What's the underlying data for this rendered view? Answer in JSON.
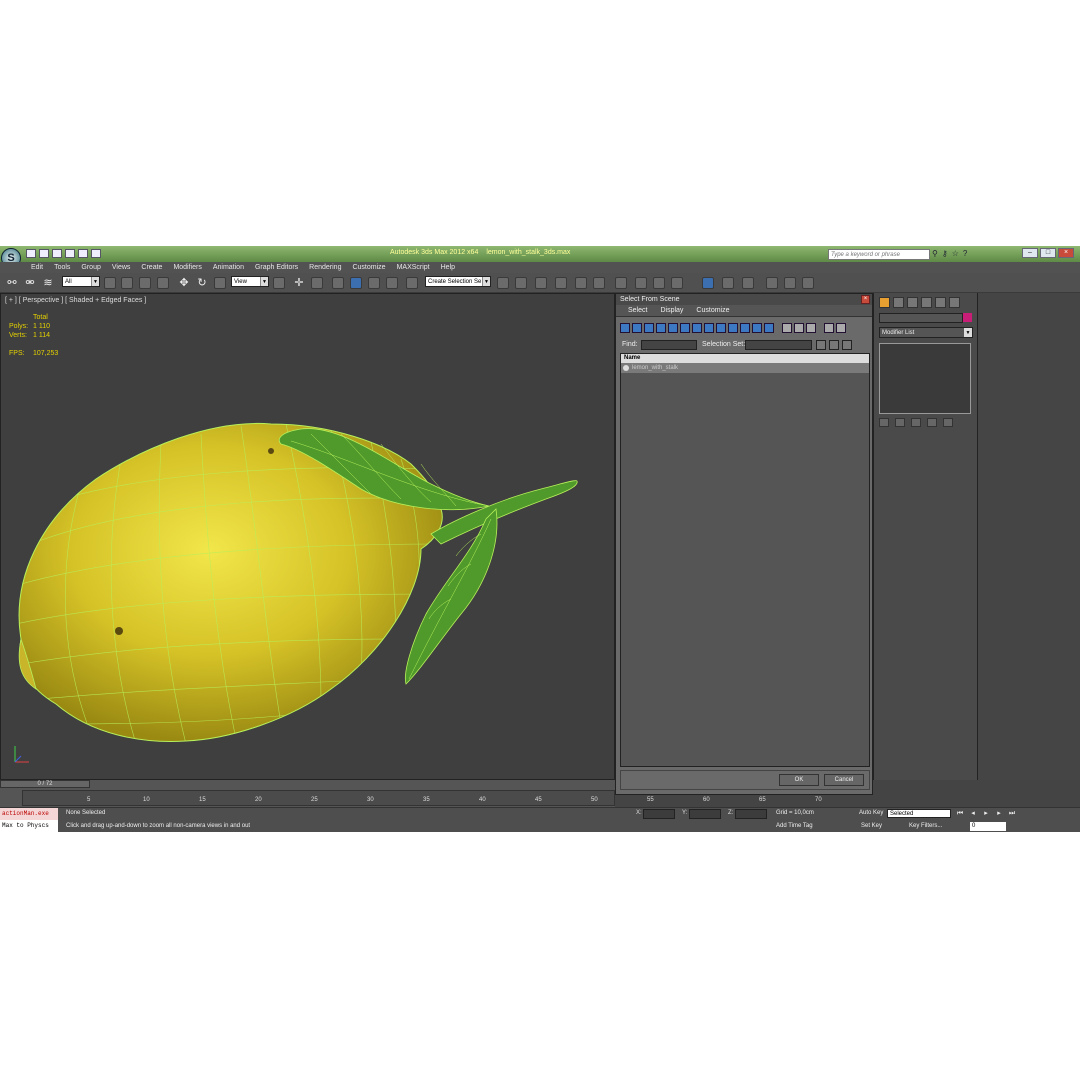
{
  "title": {
    "app": "Autodesk 3ds Max 2012 x64",
    "file": "lemon_with_stalk_3ds.max",
    "search_placeholder": "Type a keyword or phrase"
  },
  "menu": [
    "Edit",
    "Tools",
    "Group",
    "Views",
    "Create",
    "Modifiers",
    "Animation",
    "Graph Editors",
    "Rendering",
    "Customize",
    "MAXScript",
    "Help"
  ],
  "toolbar": {
    "filter": "All",
    "refcoord": "View",
    "selset": "Create Selection Se"
  },
  "viewport": {
    "label": "[ + ] [ Perspective ] [ Shaded + Edged Faces ]",
    "stats": {
      "header": "Total",
      "polys_label": "Polys:",
      "polys": "1 110",
      "verts_label": "Verts:",
      "verts": "1 114",
      "fps_label": "FPS:",
      "fps": "107,253"
    }
  },
  "dialog": {
    "title": "Select From Scene",
    "menu": [
      "Select",
      "Display",
      "Customize"
    ],
    "find_label": "Find:",
    "selset_label": "Selection Set:",
    "col_name": "Name",
    "items": [
      "lemon_with_stalk"
    ],
    "ok": "OK",
    "cancel": "Cancel"
  },
  "command_panel": {
    "modifier_list": "Modifier List",
    "accent": "#c81e78"
  },
  "timeline": {
    "frame": "0 / 72",
    "ticks": [
      "5",
      "10",
      "15",
      "20",
      "25",
      "30",
      "35",
      "40",
      "45",
      "50",
      "55",
      "60",
      "65",
      "70"
    ]
  },
  "status": {
    "maxscript1": "actionMan.exe",
    "maxscript2": "Max to Physcs",
    "selection": "None Selected",
    "prompt": "Click and drag up-and-down to zoom all non-camera views in and out",
    "x": "X:",
    "y": "Y:",
    "z": "Z:",
    "grid": "Grid = 10,0cm",
    "add_time_tag": "Add Time Tag",
    "auto_key": "Auto Key",
    "set_key": "Set Key",
    "selected": "Selected",
    "key_filters": "Key Filters...",
    "current_frame": "0"
  }
}
